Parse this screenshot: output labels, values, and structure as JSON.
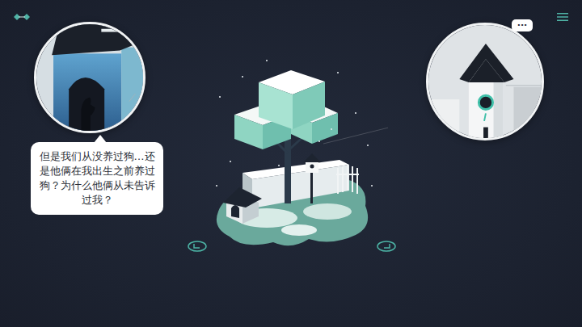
{
  "dialogue": {
    "text": "但是我们从没养过狗…还是他俩在我出生之前养过狗？为什么他俩从未告诉过我？"
  },
  "thought_bubble": {
    "text": "···"
  },
  "rotate_buttons": [
    {
      "kind": "left"
    },
    {
      "kind": "right"
    }
  ]
}
